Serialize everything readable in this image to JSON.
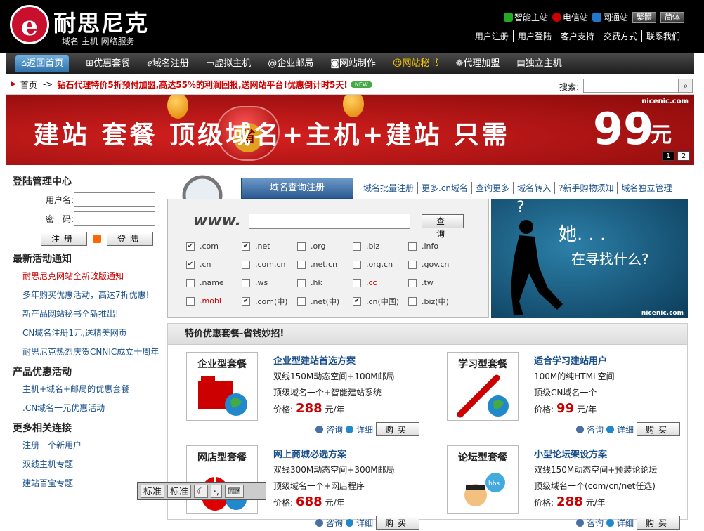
{
  "header": {
    "brand": "耐思尼克",
    "slogan": "域名 主机 网络服务",
    "top_links": [
      "智能主站",
      "电信站",
      "网通站"
    ],
    "lang_buttons": [
      "繁體",
      "简体"
    ],
    "user_links": [
      "用户注册",
      "用户登陆",
      "客户支持",
      "交费方式",
      "联系我们"
    ],
    "colors": {
      "bg": "#000000",
      "brand_red": "#c8102e"
    }
  },
  "nav": {
    "items": [
      "返回首页",
      "优惠套餐",
      "域名注册",
      "虚拟主机",
      "@企业邮局",
      "网站制作",
      "网站秘书",
      "代理加盟",
      "独立主机"
    ],
    "active": 0
  },
  "ticker": {
    "home": "首页",
    "sep": "->",
    "promo": "钻石代理特价5折预付加盟,高达55%的利润回报,送网站平台!优惠倒计时5天!",
    "badge": "NEW",
    "search_label": "搜索:"
  },
  "banner": {
    "text": "建站 套餐  顶级域名+主机+建站 只需",
    "price": "99",
    "unit": "元",
    "site": "nicenic.com",
    "seal": "省",
    "pages": [
      "1",
      "2"
    ]
  },
  "left": {
    "login_title": "登陆管理中心",
    "user_label": "用户名:",
    "pwd_label": "密　码:",
    "register_btn": "注册",
    "login_btn": "登陆",
    "news_title": "最新活动通知",
    "news": [
      "耐思尼克网站全新改版通知",
      "多年购买优惠活动，高达7折优惠!",
      "新产品网站秘书全新推出!",
      "CN域名注册1元,送精美网页",
      "耐思尼克热烈庆贺CNNIC成立十周年"
    ],
    "promo_title": "产品优惠活动",
    "promos": [
      "主机+域名+邮局的优惠套餐",
      ".CN域名一元优惠活动"
    ],
    "more_title": "更多相关连接",
    "more": [
      "注册一个新用户",
      "双线主机专题",
      "建站百宝专题"
    ]
  },
  "domain": {
    "tab": "域名查询注册",
    "links": [
      "域名批量注册",
      "更多.cn域名",
      "查询更多",
      "域名转入",
      "?新手购物须知",
      "域名独立管理"
    ],
    "www": "www.",
    "query_btn": "查询",
    "exts": [
      {
        "n": ".com",
        "c": true
      },
      {
        "n": ".net",
        "c": true
      },
      {
        "n": ".org",
        "c": false
      },
      {
        "n": ".biz",
        "c": false
      },
      {
        "n": ".info",
        "c": false
      },
      {
        "n": ".cn",
        "c": true
      },
      {
        "n": ".com.cn",
        "c": false
      },
      {
        "n": ".net.cn",
        "c": false
      },
      {
        "n": ".org.cn",
        "c": false
      },
      {
        "n": ".gov.cn",
        "c": false
      },
      {
        "n": ".name",
        "c": false
      },
      {
        "n": ".ws",
        "c": false
      },
      {
        "n": ".hk",
        "c": false
      },
      {
        "n": ".cc",
        "c": false,
        "red": true
      },
      {
        "n": ".tw",
        "c": false
      },
      {
        "n": ".mobi",
        "c": false,
        "red": true
      },
      {
        "n": ".com(中)",
        "c": true
      },
      {
        "n": ".net(中)",
        "c": false
      },
      {
        "n": ".cn(中国)",
        "c": true
      },
      {
        "n": ".biz(中)",
        "c": false
      }
    ]
  },
  "ad": {
    "q": "?",
    "t1": "她. . .",
    "t2": "在寻找什么?",
    "site": "nicenic.com"
  },
  "packages": {
    "title": "特价优惠套餐-省钱妙招!",
    "items": [
      {
        "box": "企业型套餐",
        "name": "企业型建站首选方案",
        "l1": "双线150M动态空间+100M邮局",
        "l2": "顶级域名一个+智能建站系统",
        "price_label": "价格:",
        "price": "288",
        "unit": "元/年"
      },
      {
        "box": "学习型套餐",
        "name": "适合学习建站用户",
        "l1": "100M的纯HTML空间",
        "l2": "顶级CN域名一个",
        "price_label": "价格:",
        "price": "99",
        "unit": "元/年"
      },
      {
        "box": "网店型套餐",
        "name": "网上商城必选方案",
        "l1": "双线300M动态空间+300M邮局",
        "l2": "顶级域名一个+网店程序",
        "price_label": "价格:",
        "price": "688",
        "unit": "元/年"
      },
      {
        "box": "论坛型套餐",
        "name": "小型论坛架设方案",
        "l1": "双线150M动态空间+预装论论坛",
        "l2": "顶级域名一个(com/cn/net任选)",
        "price_label": "价格:",
        "price": "288",
        "unit": "元/年"
      }
    ],
    "consult": "咨询",
    "detail": "详细",
    "buy": "购买"
  },
  "ime": {
    "labels": [
      "标准",
      "标准"
    ]
  }
}
